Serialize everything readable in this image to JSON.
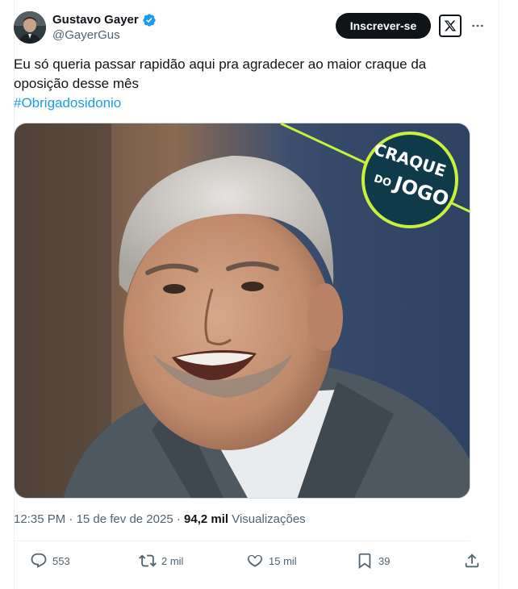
{
  "tweet": {
    "author_name": "Gustavo Gayer",
    "author_handle": "@GayerGus",
    "subscribe_label": "Inscrever-se",
    "text": "Eu só queria passar rapidão aqui pra agradecer ao maior craque da oposição desse mês",
    "hashtag": "#Obrigadosidonio",
    "media": {
      "badge_line1": "CRAQUE",
      "badge_line2": "DO",
      "badge_line3": "JOGO",
      "badge_color": "#c8f03c",
      "badge_bg": "#0f3a4a"
    },
    "time": "12:35 PM",
    "separator": "·",
    "date": "15 de fev de 2025",
    "views_count": "94,2 mil",
    "views_label": "Visualizações"
  },
  "actions": {
    "reply_count": "553",
    "retweet_count": "2 mil",
    "like_count": "15 mil",
    "bookmark_count": "39"
  },
  "colors": {
    "accent": "#1d9bf0",
    "text": "#0f1419",
    "muted": "#536471"
  },
  "icons": [
    "verified-badge-icon",
    "x-logo-icon",
    "more-icon",
    "reply-icon",
    "retweet-icon",
    "like-icon",
    "bookmark-icon",
    "share-icon"
  ]
}
